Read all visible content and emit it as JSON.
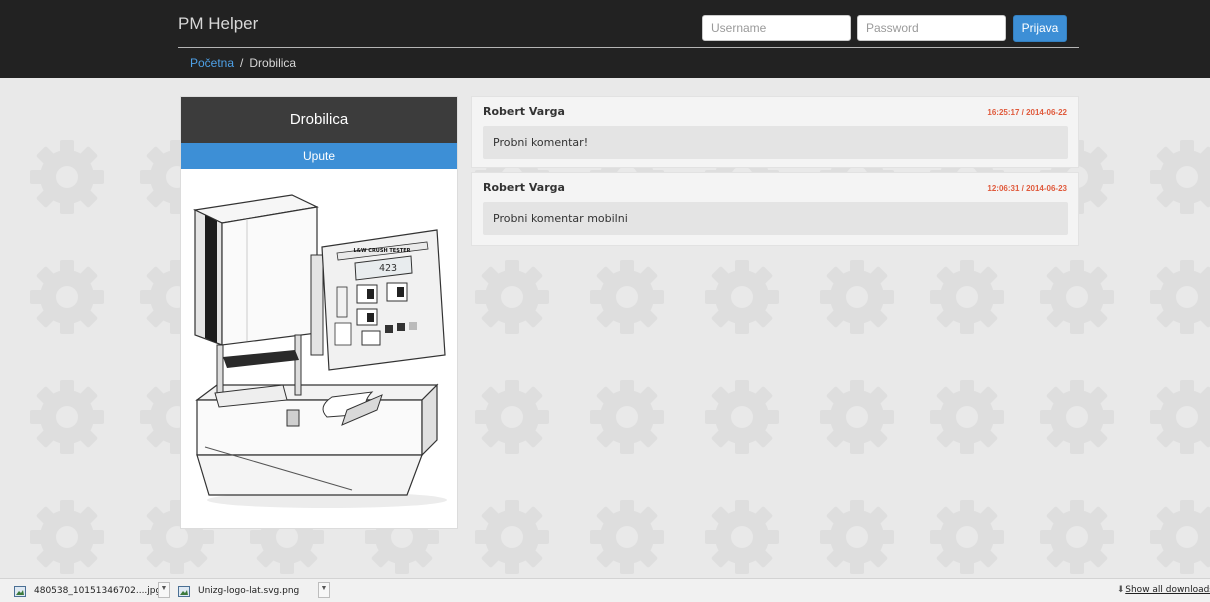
{
  "navbar": {
    "brand": "PM Helper",
    "username_placeholder": "Username",
    "password_placeholder": "Password",
    "login_label": "Prijava"
  },
  "breadcrumb": {
    "home": "Početna",
    "separator": "/",
    "current": "Drobilica"
  },
  "card": {
    "title": "Drobilica",
    "tab_label": "Upute",
    "image_text": {
      "panel_label": "L&W CRUSH TESTER",
      "display_value": "423"
    }
  },
  "comments": [
    {
      "author": "Robert Varga",
      "timestamp": "16:25:17 / 2014-06-22",
      "text": "Probni komentar!"
    },
    {
      "author": "Robert Varga",
      "timestamp": "12:06:31 / 2014-06-23",
      "text": "Probni komentar mobilni"
    }
  ],
  "downloads": {
    "items": [
      {
        "name": "480538_10151346702....jpg"
      },
      {
        "name": "Unizg-logo-lat.svg.png"
      }
    ],
    "show_all": "Show all downloads"
  },
  "colors": {
    "navbar_bg": "#222222",
    "accent": "#3d8fd6",
    "timestamp": "#e05a3c",
    "card_header": "#3c3c3c"
  }
}
